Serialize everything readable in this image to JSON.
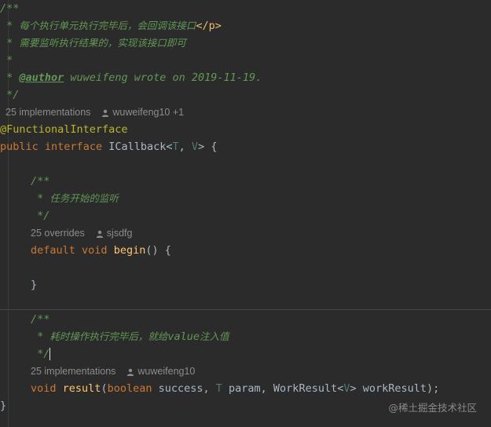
{
  "editor": {
    "lines": {
      "l1": "/**",
      "l2_prefix": " * ",
      "l2_text": "每个执行单元执行完毕后，会回调该接口",
      "l2_html": "</p>",
      "l3_prefix": " * ",
      "l3_text": "需要监听执行结果的，实现该接口即可",
      "l4": " *",
      "l5_prefix": " * ",
      "l5_tag": "@author",
      "l5_rest": " wuweifeng wrote on 2019-11-19.",
      "l6": " */",
      "annotation": "@FunctionalInterface",
      "decl_kw1": "public",
      "decl_kw2": "interface",
      "decl_name": "ICallback",
      "decl_lt": "<",
      "decl_t": "T",
      "decl_comma": ", ",
      "decl_v": "V",
      "decl_gt": ">",
      "decl_brace": " {",
      "m1_doc_open": "/**",
      "m1_doc_prefix": " * ",
      "m1_doc_text": "任务开始的监听",
      "m1_doc_close": " */",
      "m1_kw1": "default",
      "m1_kw2": "void",
      "m1_name": "begin",
      "m1_rest": "() {",
      "m1_close": "}",
      "m2_doc_open": "/**",
      "m2_doc_prefix": " * ",
      "m2_doc_text1": "耗时操作执行完毕后，就给",
      "m2_doc_code": "value",
      "m2_doc_text2": "注入值",
      "m2_doc_close": " */",
      "m2_kw": "void",
      "m2_name": "result",
      "m2_p1": "(",
      "m2_bool": "boolean",
      "m2_p2": " success, ",
      "m2_t": "T",
      "m2_p3": " param, WorkResult",
      "m2_lt": "<",
      "m2_v": "V",
      "m2_gt": ">",
      "m2_p4": " workResult);",
      "class_close": "}"
    },
    "hints": {
      "interface_impls": "25 implementations",
      "interface_author": "wuweifeng10 +1",
      "begin_overrides": "25 overrides",
      "begin_author": "sjsdfg",
      "result_impls": "25 implementations",
      "result_author": "wuweifeng10"
    }
  },
  "watermark": "@稀土掘金技术社区",
  "colors": {
    "background": "#2b2b2b",
    "doc_comment": "#629755",
    "keyword": "#cc7832",
    "annotation": "#bbb529",
    "method": "#ffc66d",
    "type_param": "#507874",
    "hint": "#8c8c8c"
  }
}
